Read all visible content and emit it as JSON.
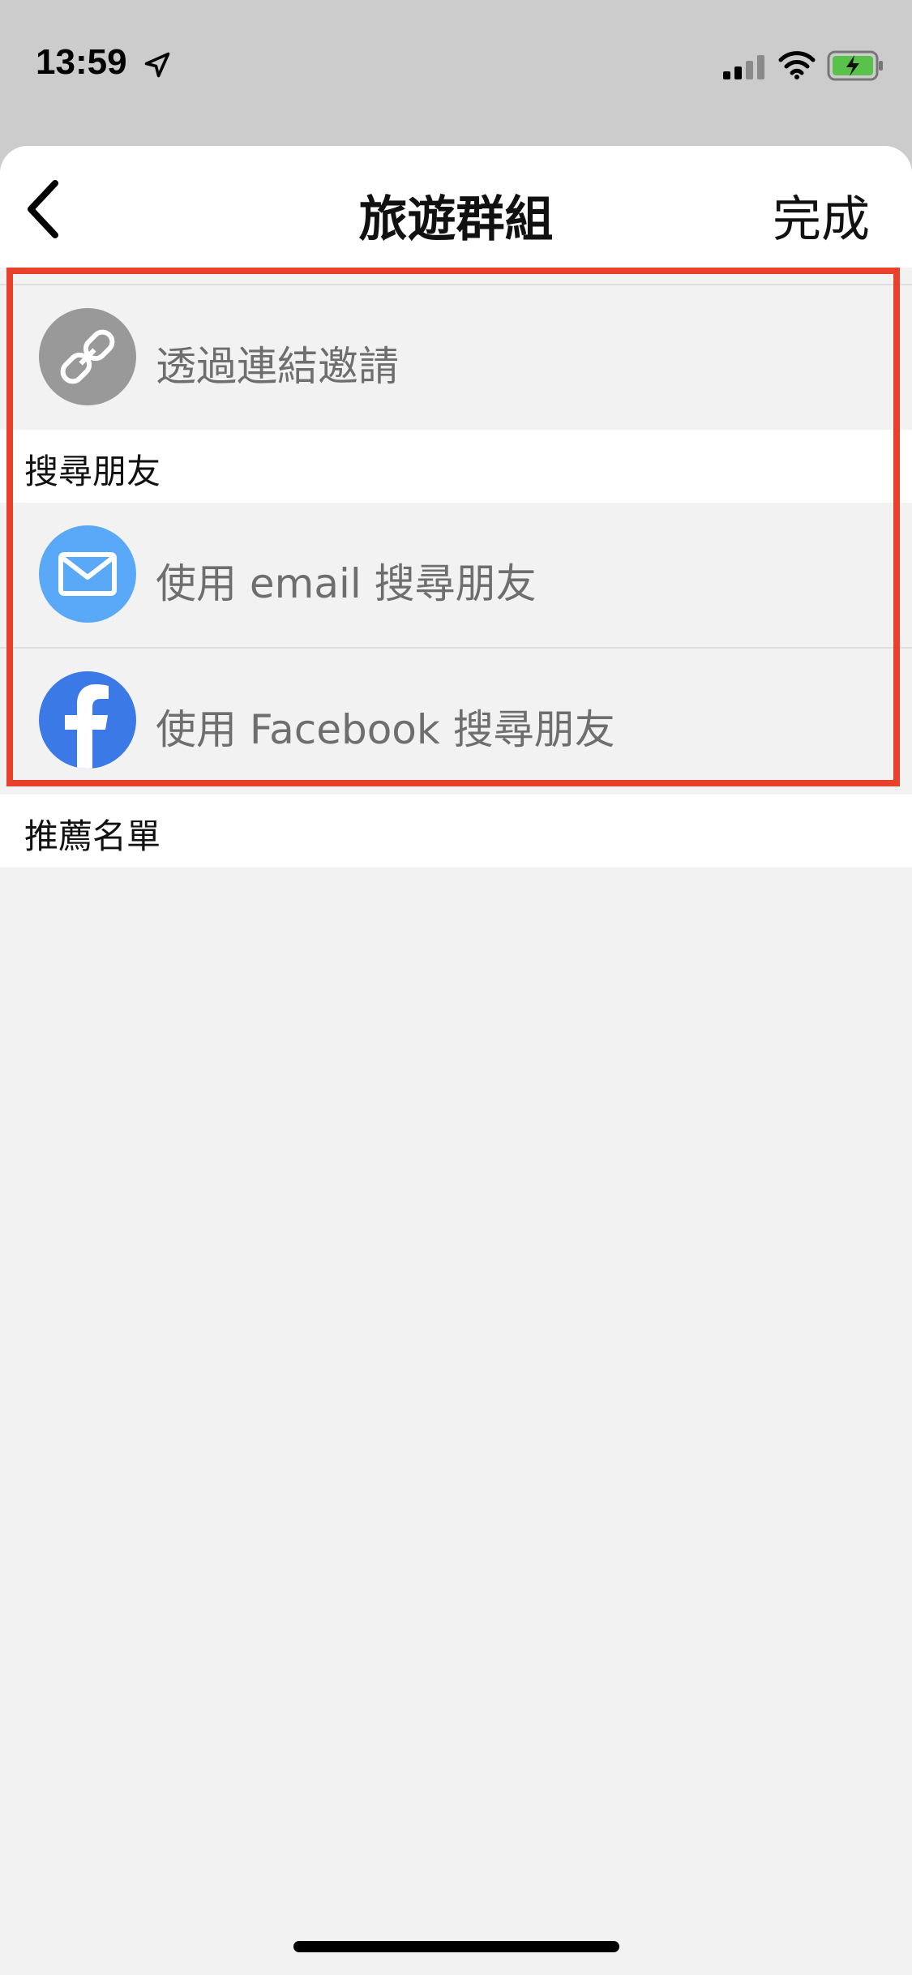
{
  "status_bar": {
    "time": "13:59",
    "icons": [
      "location-arrow-icon",
      "cellular-signal-icon",
      "wifi-icon",
      "battery-charging-icon"
    ]
  },
  "nav": {
    "back_icon": "chevron-left-icon",
    "title": "旅遊群組",
    "done_label": "完成"
  },
  "invite_link": {
    "label": "透過連結邀請",
    "icon": "link-icon",
    "icon_bg": "#999999"
  },
  "search_section": {
    "header": "搜尋朋友",
    "items": [
      {
        "label": "使用 email 搜尋朋友",
        "icon": "mail-icon",
        "icon_bg": "#5aa9f8"
      },
      {
        "label": "使用 Facebook 搜尋朋友",
        "icon": "facebook-icon",
        "icon_bg": "#3b7ae6"
      }
    ]
  },
  "recommend_section": {
    "header": "推薦名單"
  },
  "colors": {
    "highlight": "#e8402a",
    "background": "#f2f2f2"
  }
}
